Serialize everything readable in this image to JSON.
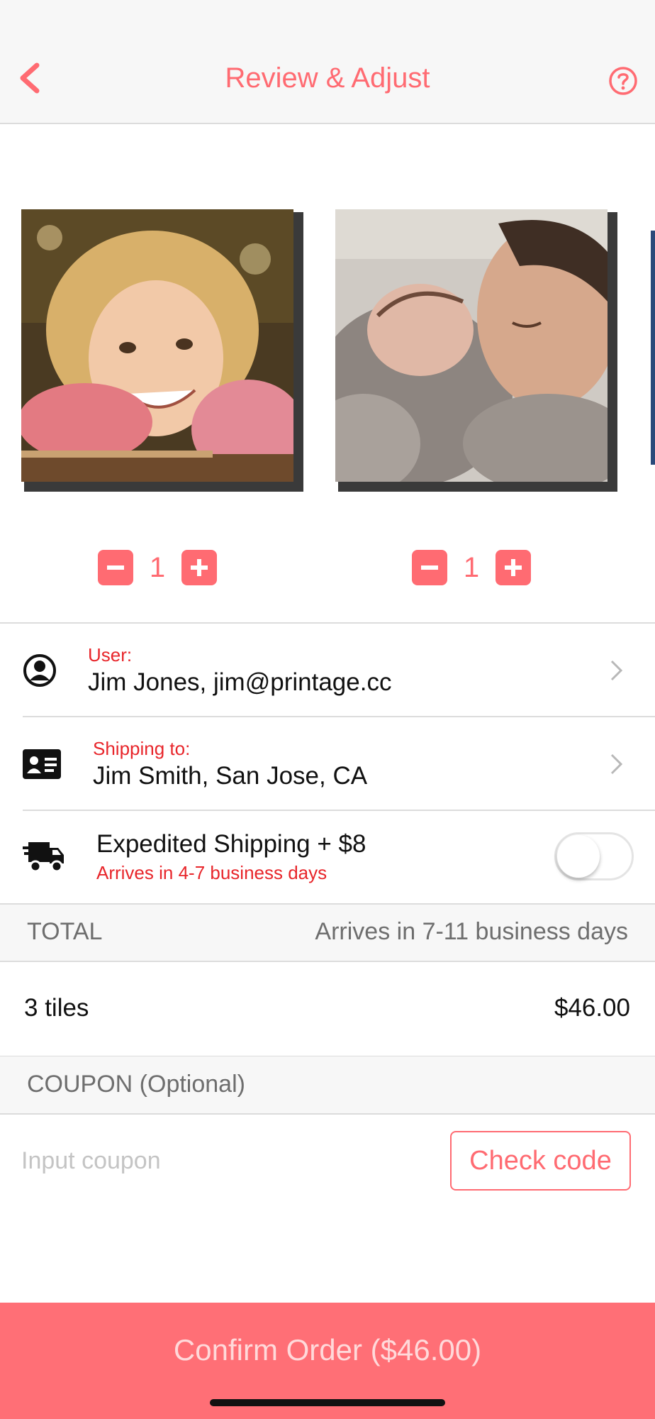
{
  "header": {
    "title": "Review & Adjust",
    "back_icon": "chevron-left-icon",
    "help_icon": "question-circle-icon",
    "accent_color": "#ff6b72"
  },
  "tiles": [
    {
      "photo_description_icon": "photo-girl",
      "quantity": "1"
    },
    {
      "photo_description_icon": "photo-father-baby",
      "quantity": "1"
    }
  ],
  "user": {
    "label": "User:",
    "value": "Jim Jones, jim@printage.cc",
    "icon": "user-circle-icon"
  },
  "shipping": {
    "label": "Shipping to:",
    "value": "Jim Smith, San Jose, CA",
    "icon": "address-card-icon"
  },
  "expedited": {
    "title": "Expedited Shipping + $8",
    "subtitle": "Arrives in 4-7 business days",
    "icon": "truck-icon",
    "enabled": false
  },
  "total": {
    "label": "TOTAL",
    "delivery": "Arrives in 7-11 business days",
    "items_label": "3 tiles",
    "price": "$46.00"
  },
  "coupon": {
    "label": "COUPON (Optional)",
    "placeholder": "Input coupon",
    "value": "",
    "check_label": "Check code"
  },
  "confirm": {
    "label": "Confirm Order ($46.00)",
    "color": "#ff6f76"
  }
}
